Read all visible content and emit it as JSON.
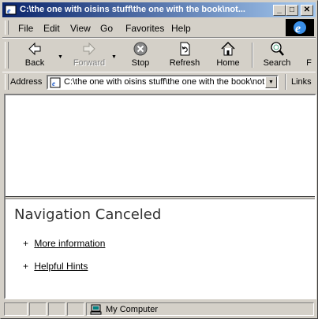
{
  "window": {
    "title": "C:\\the one with oisins stuff\\the one with the book\\not...",
    "controls": {
      "minimize": "_",
      "maximize": "□",
      "close": "✕"
    }
  },
  "menu": [
    "File",
    "Edit",
    "View",
    "Go",
    "Favorites",
    "Help"
  ],
  "toolbar": {
    "back": "Back",
    "forward": "Forward",
    "stop": "Stop",
    "refresh": "Refresh",
    "home": "Home",
    "search": "Search",
    "overflow": "F"
  },
  "address": {
    "label": "Address",
    "value": "C:\\the one with oisins stuff\\the one with the book\\not",
    "links": "Links"
  },
  "content": {
    "heading": "Navigation Canceled",
    "bullets": [
      {
        "plus": "+",
        "text": "More information"
      },
      {
        "plus": "+",
        "text": "Helpful Hints"
      }
    ]
  },
  "status": {
    "zone": "My Computer"
  },
  "colors": {
    "titlebar_start": "#0a246a",
    "titlebar_end": "#a6caf0",
    "chrome": "#d4d0c8"
  }
}
